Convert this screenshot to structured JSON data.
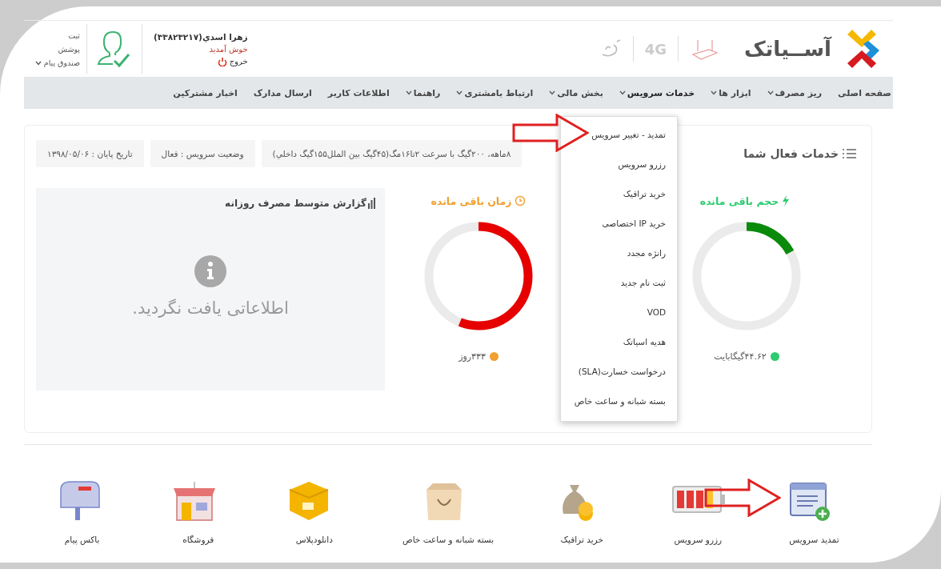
{
  "header": {
    "logo_text": "آســیاتک",
    "badge_4g": "4G",
    "user": {
      "name": "زهرا اسدي(۳۳۸۲۳۲۱۷)",
      "greeting": "خوش آمدید",
      "logout": "خروج"
    },
    "links": [
      {
        "label": "ثبت",
        "kind": "link"
      },
      {
        "label": "پوشش",
        "kind": "link"
      },
      {
        "label": "صندوق پیام",
        "kind": "dropdown"
      }
    ]
  },
  "nav": [
    {
      "label": "صفحه اصلی",
      "kind": "link",
      "expanded": false
    },
    {
      "label": "ریز مصرف",
      "kind": "dropdown",
      "expanded": false
    },
    {
      "label": "ابزار ها",
      "kind": "dropdown",
      "expanded": false
    },
    {
      "label": "خدمات سرویس",
      "kind": "dropdown",
      "expanded": true
    },
    {
      "label": "بخش مالی",
      "kind": "dropdown",
      "expanded": false
    },
    {
      "label": "ارتباط بامشتری",
      "kind": "dropdown",
      "expanded": false
    },
    {
      "label": "راهنما",
      "kind": "dropdown",
      "expanded": false
    },
    {
      "label": "اطلاعات کاربر",
      "kind": "link",
      "expanded": false
    },
    {
      "label": "ارسال مدارک",
      "kind": "link",
      "expanded": false
    },
    {
      "label": "اخبار مشترکین",
      "kind": "link",
      "expanded": false
    }
  ],
  "dropdown_items": [
    "تمدید - تغییر سرویس",
    "رزرو سرویس",
    "خرید ترافیک",
    "خرید IP اختصاصی",
    "رانژه مجدد",
    "ثبت نام جدید",
    "VOD",
    "هدیه اسیاتک",
    "درخواست خسارت(SLA)",
    "بسته شبانه و ساعت خاص"
  ],
  "services": {
    "title": "خدمات فعال شما",
    "info": [
      {
        "text": "۸ماهه، ۲۰۰گیگ  با سرعت ۲تا۱۶مگ(۴۵گیگ بین الملل۱۵۵گیگ داخلي)"
      },
      {
        "text": "وضعیت سرویس : فعال"
      },
      {
        "text": "تاریخ پایان : ۱۳۹۸/۰۵/۰۶"
      }
    ],
    "gauges": [
      {
        "kind": "volume",
        "title": "حجم باقی مانده",
        "level": 0.17,
        "value": "۴۴.۶۲گیگابایت",
        "color": "#2ecc71"
      },
      {
        "kind": "time",
        "title": "زمان باقی مانده",
        "level": 0.56,
        "value": "۳۳۳روز",
        "color": "#f0a030"
      }
    ],
    "report": {
      "title": "گزارش متوسط مصرف روزانه",
      "empty": "اطلاعاتی یافت نگردید."
    }
  },
  "shortcuts": [
    {
      "kind": "renew",
      "label": "تمدید سرویس"
    },
    {
      "kind": "reserve",
      "label": "رزرو سرویس"
    },
    {
      "kind": "traffic",
      "label": "خرید ترافیک"
    },
    {
      "kind": "night",
      "label": "بسته شبانه و ساعت خاص"
    },
    {
      "kind": "download",
      "label": "دانلودپلاس"
    },
    {
      "kind": "shop",
      "label": "فروشگاه"
    },
    {
      "kind": "mail",
      "label": "باکس پیام"
    }
  ]
}
